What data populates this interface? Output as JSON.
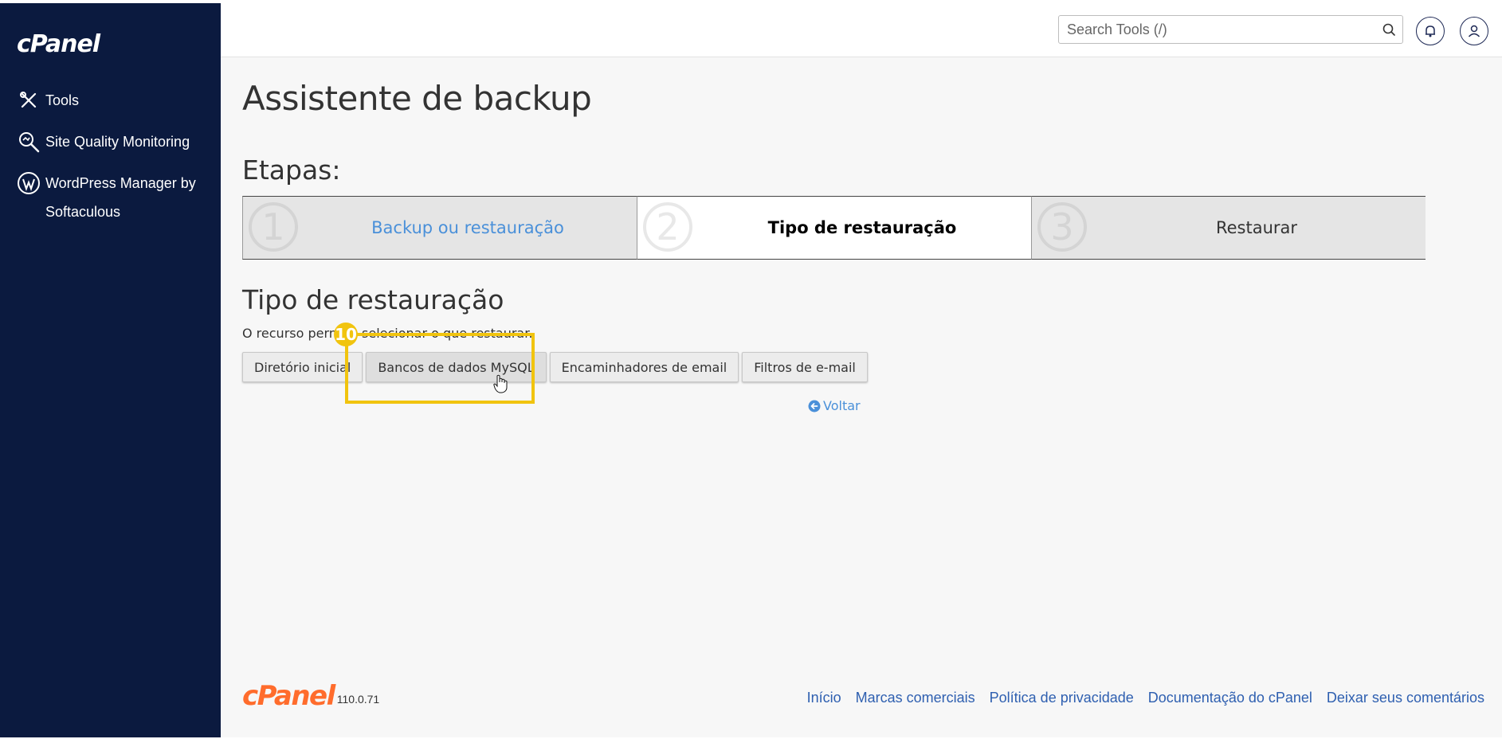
{
  "app": {
    "logo": "cPanel"
  },
  "sidebar": {
    "items": [
      {
        "label": "Tools",
        "icon": "tools-icon"
      },
      {
        "label": "Site Quality Monitoring",
        "icon": "magnifier-icon"
      },
      {
        "label": "WordPress Manager by Softaculous",
        "icon": "wordpress-icon"
      }
    ]
  },
  "header": {
    "search_placeholder": "Search Tools (/)",
    "icons": [
      "search-icon",
      "bell-icon",
      "user-icon"
    ]
  },
  "main": {
    "page_title": "Assistente de backup",
    "steps_title": "Etapas:",
    "steps": [
      {
        "num": "1",
        "label": "Backup ou restauração",
        "state": "link"
      },
      {
        "num": "2",
        "label": "Tipo de restauração",
        "state": "active"
      },
      {
        "num": "3",
        "label": "Restaurar",
        "state": "inactive"
      }
    ],
    "section_title": "Tipo de restauração",
    "description": "O recurso permite selecionar o que restaurar.",
    "buttons": [
      "Diretório inicial",
      "Bancos de dados MySQL",
      "Encaminhadores de email",
      "Filtros de e-mail"
    ],
    "back_label": "Voltar"
  },
  "annotation": {
    "marker": "10",
    "color": "#f1c40f"
  },
  "footer": {
    "brand": "cPanel",
    "version": "110.0.71",
    "links": [
      "Início",
      "Marcas comerciais",
      "Política de privacidade",
      "Documentação do cPanel",
      "Deixar seus comentários"
    ]
  },
  "colors": {
    "sidebar_bg": "#0b1a3f",
    "link": "#4a90d9",
    "footer_link": "#2e5fb0",
    "brand_orange": "#ff6c2c"
  }
}
